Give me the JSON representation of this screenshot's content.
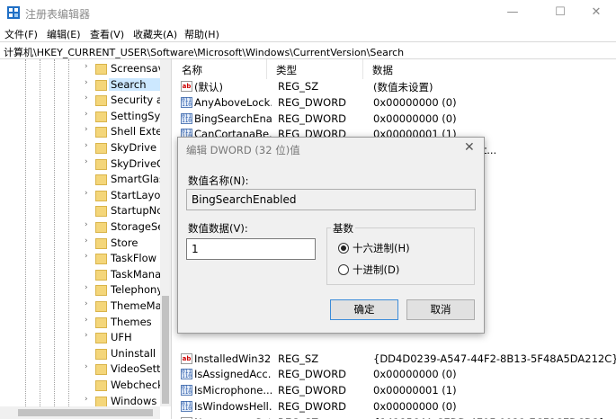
{
  "window": {
    "title": "注册表编辑器",
    "minimize_glyph": "—",
    "maximize_glyph": "☐",
    "close_glyph": "✕"
  },
  "menu": [
    "文件(F)",
    "编辑(E)",
    "查看(V)",
    "收藏夹(A)",
    "帮助(H)"
  ],
  "address": "计算机\\HKEY_CURRENT_USER\\Software\\Microsoft\\Windows\\CurrentVersion\\Search",
  "tree": {
    "items": [
      {
        "label": "Screensav",
        "arrow": "›"
      },
      {
        "label": "Search",
        "arrow": "›",
        "selected": true
      },
      {
        "label": "Security ar",
        "arrow": "›"
      },
      {
        "label": "SettingSyn",
        "arrow": "›"
      },
      {
        "label": "Shell Exten",
        "arrow": "›"
      },
      {
        "label": "SkyDrive",
        "arrow": "›"
      },
      {
        "label": "SkyDriveO",
        "arrow": "›"
      },
      {
        "label": "SmartGlas",
        "arrow": ""
      },
      {
        "label": "StartLayou",
        "arrow": "›"
      },
      {
        "label": "StartupNo",
        "arrow": ""
      },
      {
        "label": "StorageSe",
        "arrow": "›"
      },
      {
        "label": "Store",
        "arrow": "›"
      },
      {
        "label": "TaskFlow",
        "arrow": "›"
      },
      {
        "label": "TaskMana",
        "arrow": ""
      },
      {
        "label": "Telephony",
        "arrow": "›"
      },
      {
        "label": "ThemeMa",
        "arrow": "›"
      },
      {
        "label": "Themes",
        "arrow": "›"
      },
      {
        "label": "UFH",
        "arrow": "›"
      },
      {
        "label": "Uninstall",
        "arrow": ""
      },
      {
        "label": "VideoSetti",
        "arrow": "›"
      },
      {
        "label": "Webcheck",
        "arrow": ""
      },
      {
        "label": "Windows",
        "arrow": "›"
      }
    ]
  },
  "list": {
    "columns": [
      "名称",
      "类型",
      "数据"
    ],
    "rows": [
      {
        "icon": "string-value-icon",
        "name": "(默认)",
        "type": "REG_SZ",
        "data": "(数值未设置)"
      },
      {
        "icon": "binary-value-icon",
        "name": "AnyAboveLock...",
        "type": "REG_DWORD",
        "data": "0x00000000 (0)"
      },
      {
        "icon": "binary-value-icon",
        "name": "BingSearchEna...",
        "type": "REG_DWORD",
        "data": "0x00000000 (0)"
      },
      {
        "icon": "binary-value-icon",
        "name": "CanCortanaBe...",
        "type": "REG_DWORD",
        "data": "0x00000001 (1)"
      },
      {
        "icon": "string-value-icon",
        "name": "",
        "type": "",
        "data": "ar,CallHistory,Contact..."
      },
      {
        "icon": "",
        "name": "",
        "type": "",
        "data": ""
      },
      {
        "icon": "",
        "name": "",
        "type": "",
        "data": ""
      },
      {
        "icon": "",
        "name": "",
        "type": "",
        "data": ""
      },
      {
        "icon": "",
        "name": "",
        "type": "",
        "data": "78bef0b005831f6aa0"
      },
      {
        "icon": "",
        "name": "",
        "type": "",
        "data": ""
      },
      {
        "icon": "",
        "name": "",
        "type": "",
        "data": ")"
      },
      {
        "icon": "",
        "name": "",
        "type": "",
        "data": ""
      },
      {
        "icon": "",
        "name": "",
        "type": "",
        "data": ""
      },
      {
        "icon": "",
        "name": "",
        "type": "",
        "data": ""
      },
      {
        "icon": "",
        "name": "",
        "type": "",
        "data": ""
      },
      {
        "icon": "",
        "name": "",
        "type": "",
        "data": ""
      },
      {
        "icon": "",
        "name": "",
        "type": "",
        "data": ""
      },
      {
        "icon": "string-value-icon",
        "name": "InstalledWin32...",
        "type": "REG_SZ",
        "data": "{DD4D0239-A547-44F2-8B13-5F48A5DA212C}"
      },
      {
        "icon": "binary-value-icon",
        "name": "IsAssignedAcc...",
        "type": "REG_DWORD",
        "data": "0x00000000 (0)"
      },
      {
        "icon": "binary-value-icon",
        "name": "IsMicrophone...",
        "type": "REG_DWORD",
        "data": "0x00000001 (1)"
      },
      {
        "icon": "binary-value-icon",
        "name": "IsWindowsHell...",
        "type": "REG_DWORD",
        "data": "0x00000000 (0)"
      },
      {
        "icon": "string-value-icon",
        "name": "NamespaceSet...",
        "type": "REG_SZ",
        "data": "{1418564A-CEDD-4E9F-9921-7CF8CEDCD2}"
      }
    ]
  },
  "dialog": {
    "title": "编辑 DWORD (32 位)值",
    "close_glyph": "✕",
    "name_label": "数值名称(N):",
    "name_value": "BingSearchEnabled",
    "data_label": "数值数据(V):",
    "data_value": "1",
    "base_label": "基数",
    "radio_hex": "十六进制(H)",
    "radio_dec": "十进制(D)",
    "hex_selected": true,
    "ok_label": "确定",
    "cancel_label": "取消"
  }
}
